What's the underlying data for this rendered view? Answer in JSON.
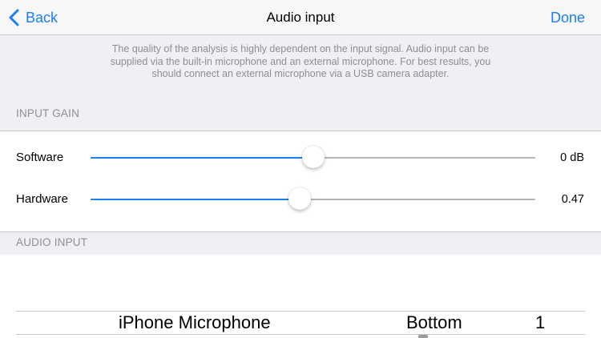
{
  "navbar": {
    "back_label": "Back",
    "title": "Audio input",
    "done_label": "Done"
  },
  "description": "The quality of the analysis is highly dependent on the input signal. Audio input can be supplied via the built-in microphone and an external microphone. For best results, you should connect an external microphone via a USB camera adapter.",
  "input_gain": {
    "header": "INPUT GAIN",
    "software": {
      "label": "Software",
      "value": "0 dB",
      "position_fraction": 0.5
    },
    "hardware": {
      "label": "Hardware",
      "value": "0.47",
      "position_fraction": 0.47
    }
  },
  "audio_input": {
    "header": "AUDIO INPUT",
    "picker": {
      "device": "iPhone Microphone",
      "position": "Bottom",
      "channel": "1"
    }
  },
  "colors": {
    "accent": "#1a7ef5",
    "track": "#b6b6b6",
    "background": "#efeff4",
    "secondary_text": "#8e8e93"
  },
  "icons": {
    "back": "chevron-left-icon"
  }
}
